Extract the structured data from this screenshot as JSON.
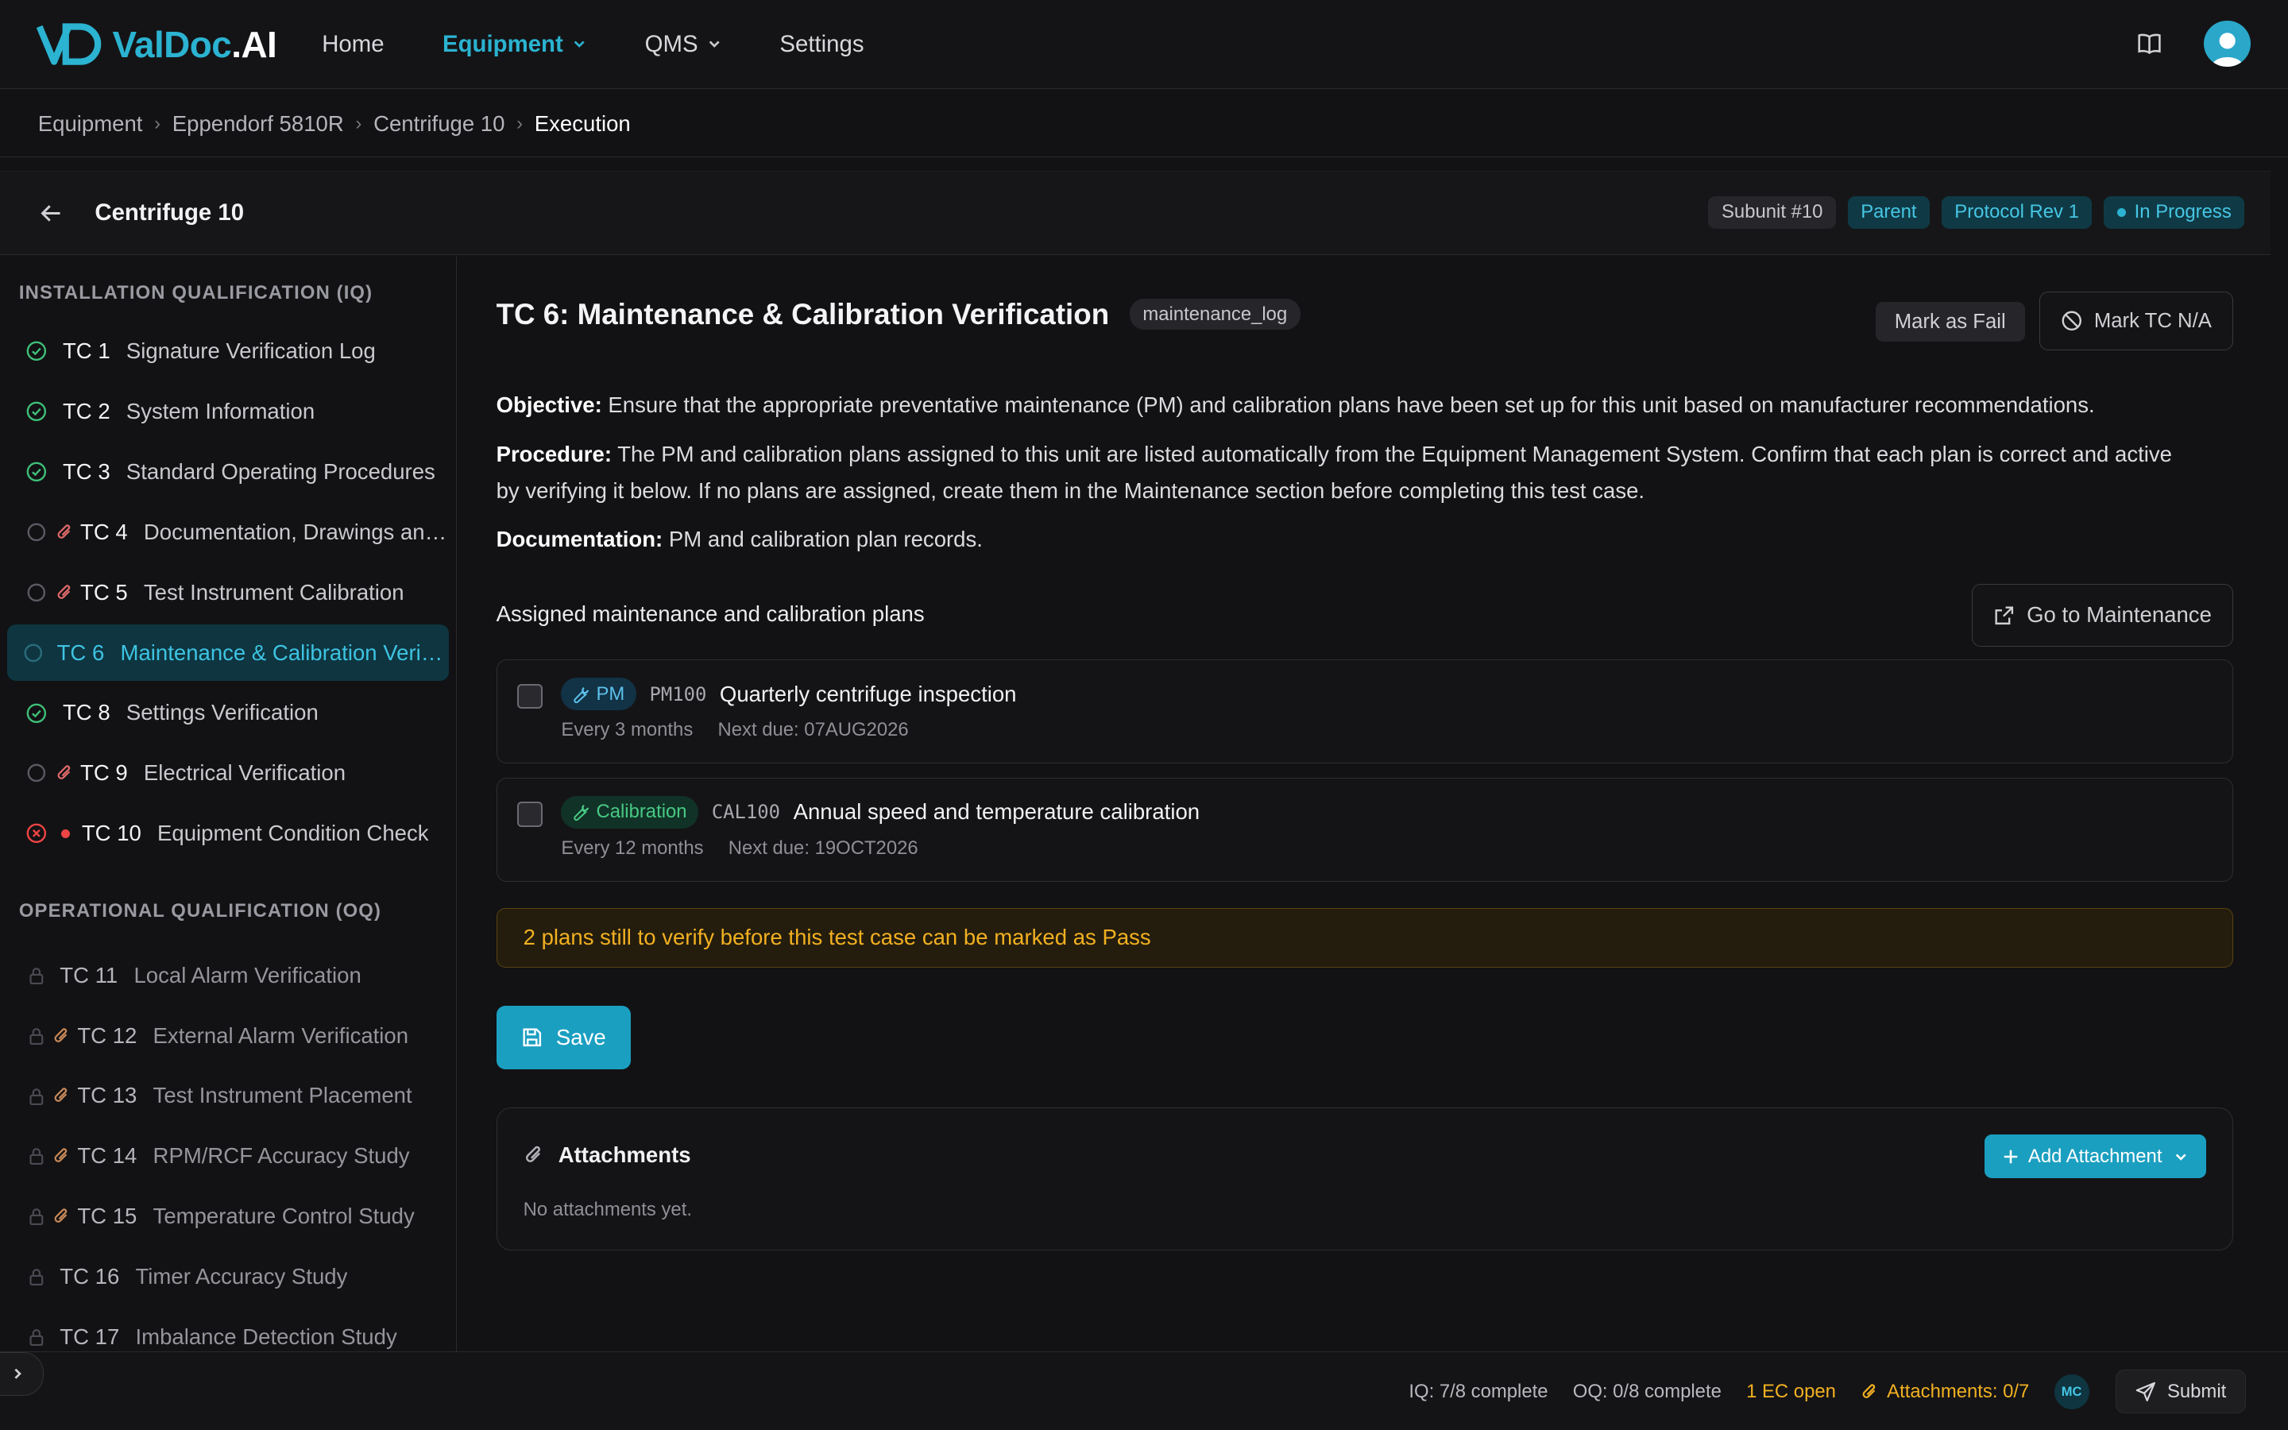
{
  "app": {
    "logo_part1": "ValDoc",
    "logo_part2": ".AI"
  },
  "nav": {
    "home": "Home",
    "equipment": "Equipment",
    "qms": "QMS",
    "settings": "Settings"
  },
  "breadcrumb": [
    "Equipment",
    "Eppendorf 5810R",
    "Centrifuge 10",
    "Execution"
  ],
  "header": {
    "title": "Centrifuge 10",
    "badges": {
      "subunit": "Subunit #10",
      "parent": "Parent",
      "protocol": "Protocol Rev 1",
      "status": "In Progress"
    }
  },
  "sidebar": {
    "iq_label": "INSTALLATION QUALIFICATION (IQ)",
    "oq_label": "OPERATIONAL QUALIFICATION (OQ)",
    "iq_items": [
      {
        "num": "TC 1",
        "name": "Signature Verification Log",
        "status": "done"
      },
      {
        "num": "TC 2",
        "name": "System Information",
        "status": "done"
      },
      {
        "num": "TC 3",
        "name": "Standard Operating Procedures",
        "status": "done"
      },
      {
        "num": "TC 4",
        "name": "Documentation, Drawings and Manuals",
        "status": "pending-attach"
      },
      {
        "num": "TC 5",
        "name": "Test Instrument Calibration",
        "status": "pending-attach"
      },
      {
        "num": "TC 6",
        "name": "Maintenance & Calibration Verification",
        "status": "active"
      },
      {
        "num": "TC 8",
        "name": "Settings Verification",
        "status": "done"
      },
      {
        "num": "TC 9",
        "name": "Electrical Verification",
        "status": "pending-attach"
      },
      {
        "num": "TC 10",
        "name": "Equipment Condition Check",
        "status": "failed"
      }
    ],
    "oq_items": [
      {
        "num": "TC 11",
        "name": "Local Alarm Verification",
        "attach": false
      },
      {
        "num": "TC 12",
        "name": "External Alarm Verification",
        "attach": true
      },
      {
        "num": "TC 13",
        "name": "Test Instrument Placement",
        "attach": true
      },
      {
        "num": "TC 14",
        "name": "RPM/RCF Accuracy Study",
        "attach": true
      },
      {
        "num": "TC 15",
        "name": "Temperature Control Study",
        "attach": true
      },
      {
        "num": "TC 16",
        "name": "Timer Accuracy Study",
        "attach": false
      },
      {
        "num": "TC 17",
        "name": "Imbalance Detection Study",
        "attach": false
      }
    ]
  },
  "main": {
    "title": "TC 6: Maintenance & Calibration Verification",
    "tag": "maintenance_log",
    "mark_fail": "Mark as Fail",
    "mark_na": "Mark TC N/A",
    "objective_label": "Objective:",
    "objective_text": " Ensure that the appropriate preventative maintenance (PM) and calibration plans have been set up for this unit based on manufacturer recommendations.",
    "procedure_label": "Procedure:",
    "procedure_text": " The PM and calibration plans assigned to this unit are listed automatically from the Equipment Management System. Confirm that each plan is correct and active by verifying it below. If no plans are assigned, create them in the Maintenance section before completing this test case.",
    "documentation_label": "Documentation:",
    "documentation_text": " PM and calibration plan records.",
    "assigned_label": "Assigned maintenance and calibration plans",
    "go_maintenance": "Go to Maintenance",
    "plans": [
      {
        "type": "PM",
        "code": "PM100",
        "title": "Quarterly centrifuge inspection",
        "freq": "Every 3 months",
        "next": "Next due: 07AUG2026"
      },
      {
        "type": "Calibration",
        "code": "CAL100",
        "title": "Annual speed and temperature calibration",
        "freq": "Every 12 months",
        "next": "Next due: 19OCT2026"
      }
    ],
    "warning": "2 plans still to verify before this test case can be marked as Pass",
    "save": "Save",
    "attachments_title": "Attachments",
    "attachments_empty": "No attachments yet.",
    "add_attachment": "Add Attachment"
  },
  "footer": {
    "iq": "IQ: 7/8 complete",
    "oq": "OQ: 0/8 complete",
    "ec": "1 EC open",
    "attachments": "Attachments: 0/7",
    "user_initials": "MC",
    "submit": "Submit"
  },
  "colors": {
    "accent": "#2bb3d1",
    "warning": "#f2b021",
    "success": "#3fbf78",
    "danger": "#ef4444"
  }
}
